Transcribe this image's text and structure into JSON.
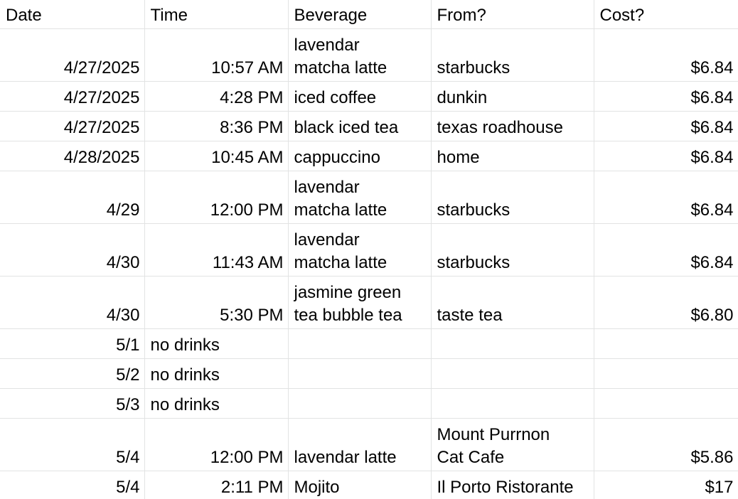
{
  "headers": [
    "Date",
    "Time",
    "Beverage",
    "From?",
    "Cost?"
  ],
  "rows": [
    {
      "date": "4/27/2025",
      "time": "10:57 AM",
      "beverage": "lavendar\nmatcha latte",
      "from": "starbucks",
      "cost": "$6.84"
    },
    {
      "date": "4/27/2025",
      "time": "4:28 PM",
      "beverage": "iced coffee",
      "from": "dunkin",
      "cost": "$6.84"
    },
    {
      "date": "4/27/2025",
      "time": "8:36 PM",
      "beverage": "black iced tea",
      "from": "texas roadhouse",
      "cost": "$6.84"
    },
    {
      "date": "4/28/2025",
      "time": "10:45 AM",
      "beverage": "cappuccino",
      "from": "home",
      "cost": "$6.84"
    },
    {
      "date": "4/29",
      "time": "12:00 PM",
      "beverage": "lavendar\nmatcha latte",
      "from": "starbucks",
      "cost": "$6.84"
    },
    {
      "date": "4/30",
      "time": "11:43 AM",
      "beverage": "lavendar\nmatcha latte",
      "from": "starbucks",
      "cost": "$6.84"
    },
    {
      "date": "4/30",
      "time": "5:30 PM",
      "beverage": "jasmine green\ntea bubble tea",
      "from": "taste tea",
      "cost": "$6.80"
    },
    {
      "date": "5/1",
      "time": "no drinks",
      "beverage": "",
      "from": "",
      "cost": ""
    },
    {
      "date": "5/2",
      "time": "no drinks",
      "beverage": "",
      "from": "",
      "cost": ""
    },
    {
      "date": "5/3",
      "time": "no drinks",
      "beverage": "",
      "from": "",
      "cost": ""
    },
    {
      "date": "5/4",
      "time": "12:00 PM",
      "beverage": "lavendar latte",
      "from": "Mount Purrnon\nCat Cafe",
      "cost": "$5.86"
    },
    {
      "date": "5/4",
      "time": "2:11 PM",
      "beverage": "Mojito",
      "from": "Il Porto Ristorante",
      "cost": "$17"
    }
  ]
}
